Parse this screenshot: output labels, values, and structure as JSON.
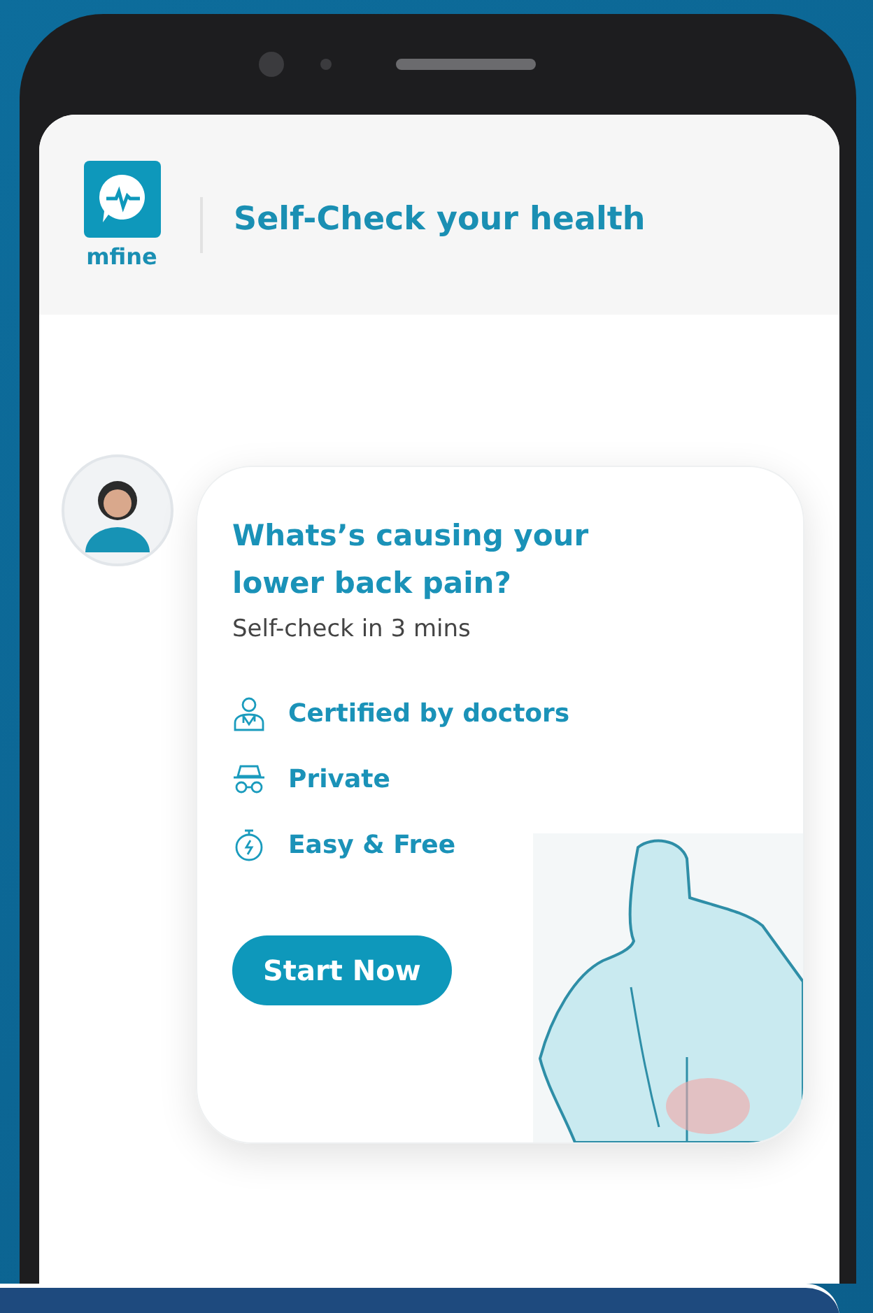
{
  "header": {
    "logo_text": "mfine",
    "title": "Self-Check your health"
  },
  "card": {
    "title": "Whats’s causing your lower back pain?",
    "subtitle": "Self-check in 3 mins",
    "features": [
      {
        "kind": "doctor",
        "label": "Certified by doctors"
      },
      {
        "kind": "incognito",
        "label": "Private"
      },
      {
        "kind": "stopwatch",
        "label": "Easy & Free"
      }
    ],
    "button": "Start Now"
  }
}
